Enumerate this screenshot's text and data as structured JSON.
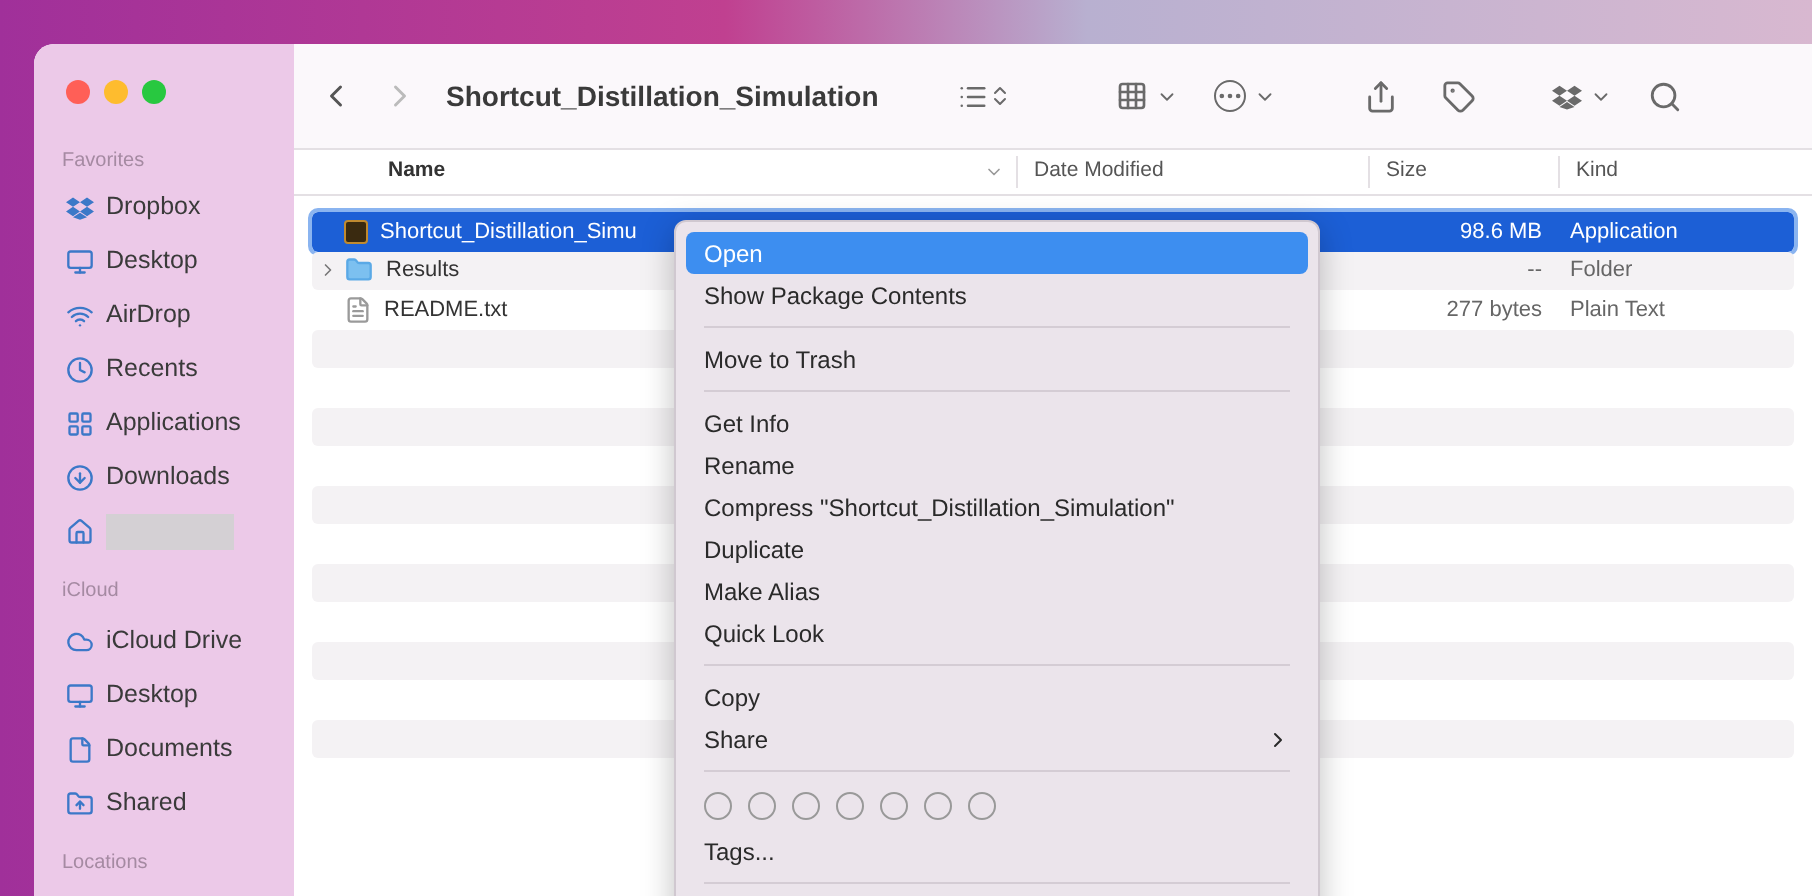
{
  "window": {
    "title": "Shortcut_Distillation_Simulation"
  },
  "sidebar": {
    "sections": [
      {
        "title": "Favorites",
        "items": [
          {
            "kind": "label",
            "label": "Dropbox"
          },
          {
            "kind": "label",
            "label": "Desktop"
          },
          {
            "kind": "label",
            "label": "AirDrop"
          },
          {
            "kind": "label",
            "label": "Recents"
          },
          {
            "kind": "label",
            "label": "Applications"
          },
          {
            "kind": "label",
            "label": "Downloads"
          },
          {
            "kind": "redacted"
          }
        ]
      },
      {
        "title": "iCloud",
        "items": [
          {
            "kind": "label",
            "label": "iCloud Drive"
          },
          {
            "kind": "label",
            "label": "Desktop"
          },
          {
            "kind": "label",
            "label": "Documents"
          },
          {
            "kind": "label",
            "label": "Shared"
          }
        ]
      },
      {
        "title": "Locations"
      }
    ]
  },
  "table": {
    "columns": [
      "Name",
      "Date Modified",
      "Size",
      "Kind"
    ],
    "rows": [
      {
        "kind": "app",
        "name": "Shortcut_Distillation_Simu",
        "size": "98.6 MB",
        "file_kind": "Application",
        "selected": true,
        "expandable": false
      },
      {
        "kind": "folder",
        "name": "Results",
        "size": "--",
        "file_kind": "Folder",
        "selected": false,
        "expandable": true
      },
      {
        "kind": "file",
        "name": "README.txt",
        "size": "277 bytes",
        "file_kind": "Plain Text",
        "selected": false,
        "expandable": false
      }
    ]
  },
  "context_menu": {
    "items": [
      {
        "kind": "item",
        "label": "Open",
        "selected": true
      },
      {
        "kind": "item",
        "label": "Show Package Contents",
        "selected": false
      },
      {
        "kind": "separator"
      },
      {
        "kind": "item",
        "label": "Move to Trash",
        "selected": false
      },
      {
        "kind": "separator"
      },
      {
        "kind": "item",
        "label": "Get Info",
        "selected": false
      },
      {
        "kind": "item",
        "label": "Rename",
        "selected": false
      },
      {
        "kind": "item",
        "label": "Compress \"Shortcut_Distillation_Simulation\"",
        "selected": false
      },
      {
        "kind": "item",
        "label": "Duplicate",
        "selected": false
      },
      {
        "kind": "item",
        "label": "Make Alias",
        "selected": false
      },
      {
        "kind": "item",
        "label": "Quick Look",
        "selected": false
      },
      {
        "kind": "separator"
      },
      {
        "kind": "item",
        "label": "Copy",
        "selected": false
      },
      {
        "kind": "submenu",
        "label": "Share",
        "selected": false
      },
      {
        "kind": "separator"
      },
      {
        "kind": "tag_colors"
      },
      {
        "kind": "item",
        "label": "Tags...",
        "selected": false
      },
      {
        "kind": "separator"
      }
    ]
  }
}
